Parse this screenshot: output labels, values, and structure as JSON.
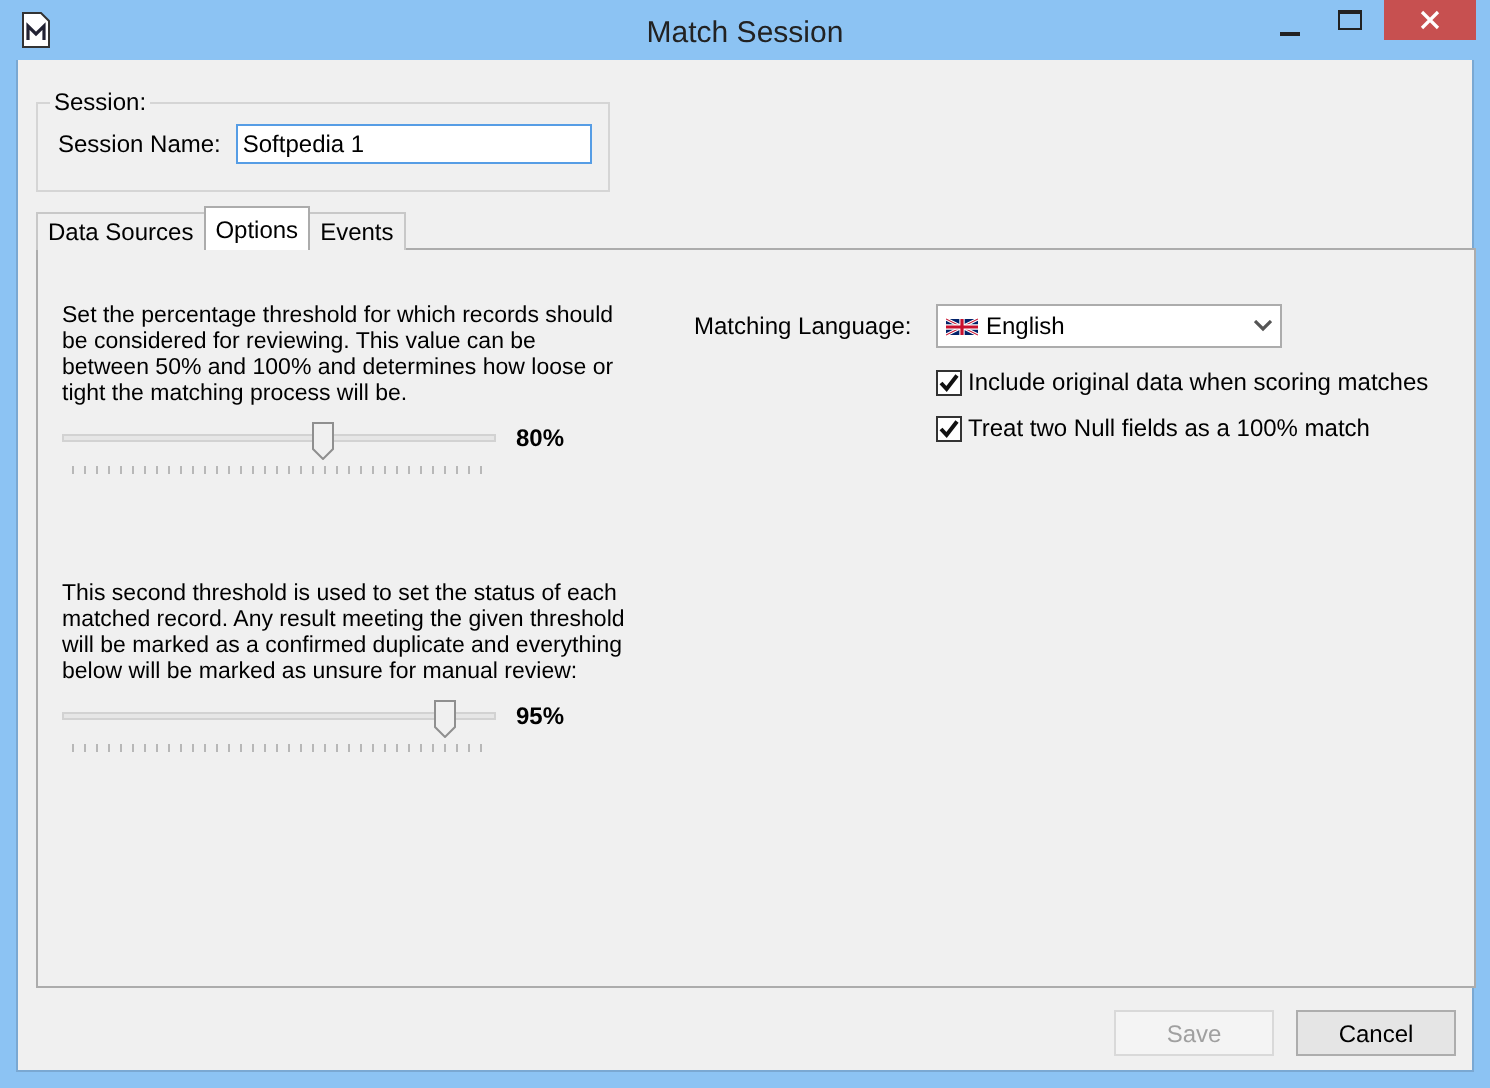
{
  "window": {
    "title": "Match Session"
  },
  "session": {
    "legend": "Session:",
    "label": "Session Name:",
    "value": "Softpedia 1"
  },
  "tabs": [
    {
      "label": "Data Sources",
      "selected": false
    },
    {
      "label": "Options",
      "selected": true
    },
    {
      "label": "Events",
      "selected": false
    }
  ],
  "thresholds": [
    {
      "description": "Set the percentage threshold for which records should be considered for reviewing. This value can be between 50% and 100% and determines how loose or tight the matching process will be.",
      "level": 0.6,
      "reading": "80%"
    },
    {
      "description": "This second threshold is used to set the status of each matched record. Any result meeting the given threshold will be marked as a confirmed duplicate and everything below will be marked as unsure for manual review:",
      "level": 0.88,
      "reading": "95%"
    }
  ],
  "language": {
    "label": "Matching Language:",
    "value": "English"
  },
  "checkboxes": [
    {
      "label": "Include original data when scoring matches",
      "checked": true
    },
    {
      "label": "Treat two Null fields as a 100% match",
      "checked": true
    }
  ],
  "buttons": [
    {
      "label": "Save",
      "disabled": true
    },
    {
      "label": "Cancel",
      "disabled": false
    }
  ]
}
